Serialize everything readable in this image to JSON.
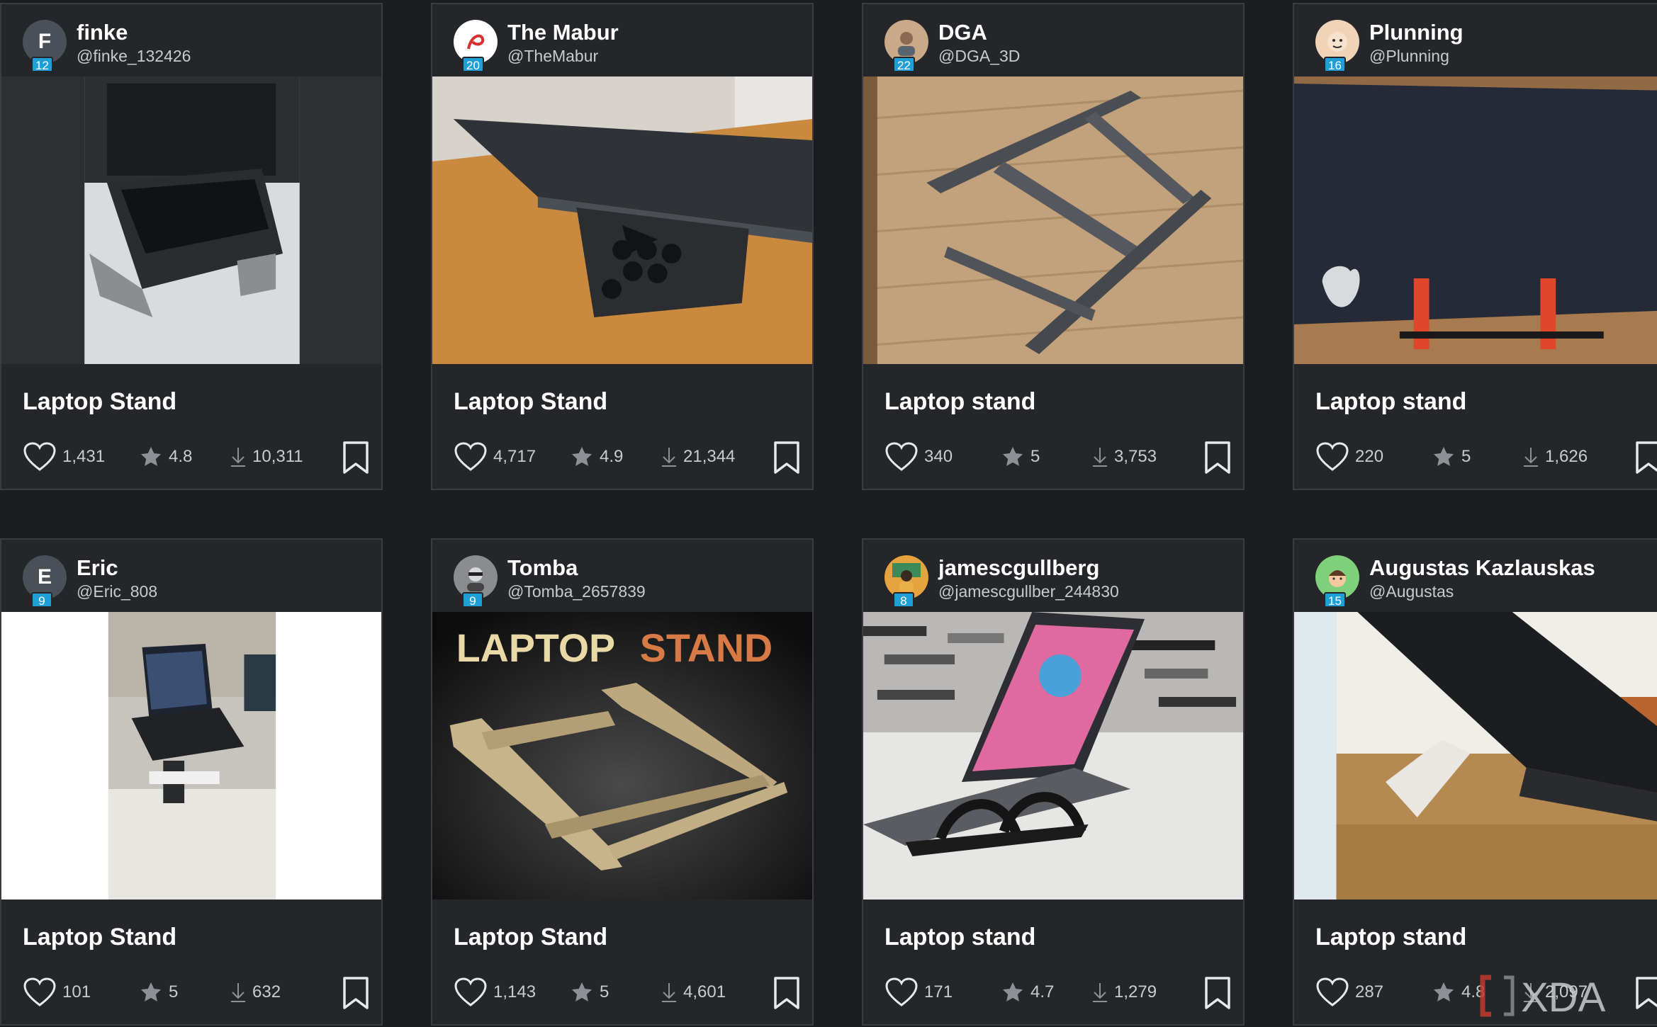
{
  "cards": [
    {
      "user": {
        "name": "finke",
        "handle": "@finke_132426",
        "initial": "F",
        "level": "12",
        "avatar_color": "#4b4f57"
      },
      "title": "Laptop Stand",
      "likes": "1,431",
      "rating": "4.8",
      "downloads": "10,311",
      "image": "thinkpad-on-printed-stand-photo"
    },
    {
      "user": {
        "name": "The Mabur",
        "handle": "@TheMabur",
        "initial": "",
        "level": "20",
        "avatar_color": "#ffffff"
      },
      "title": "Laptop Stand",
      "likes": "4,717",
      "rating": "4.9",
      "downloads": "21,344",
      "image": "honeycomb-stand-under-laptop-photo"
    },
    {
      "user": {
        "name": "DGA",
        "handle": "@DGA_3D",
        "initial": "",
        "level": "22",
        "avatar_color": "#c9a98a"
      },
      "title": "Laptop stand",
      "likes": "340",
      "rating": "5",
      "downloads": "3,753",
      "image": "carbon-fiber-folding-stand-photo"
    },
    {
      "user": {
        "name": "Plunning",
        "handle": "@Plunning",
        "initial": "",
        "level": "16",
        "avatar_color": "#f0d4b8"
      },
      "title": "Laptop stand",
      "likes": "220",
      "rating": "5",
      "downloads": "1,626",
      "image": "vertical-laptop-holder-photo"
    },
    {
      "user": {
        "name": "Eric",
        "handle": "@Eric_808",
        "initial": "E",
        "level": "9",
        "avatar_color": "#4b4f57"
      },
      "title": "Laptop Stand",
      "likes": "101",
      "rating": "5",
      "downloads": "632",
      "image": "laptop-on-desk-clamp-arm-photo"
    },
    {
      "user": {
        "name": "Tomba",
        "handle": "@Tomba_2657839",
        "initial": "",
        "level": "9",
        "avatar_color": "#8a8c90"
      },
      "title": "Laptop Stand",
      "likes": "1,143",
      "rating": "5",
      "downloads": "4,601",
      "image": "laptop-stand-render",
      "image_text_1": "LAPTOP",
      "image_text_2": "STAND"
    },
    {
      "user": {
        "name": "jamescgullberg",
        "handle": "@jamescgullber_244830",
        "initial": "",
        "level": "8",
        "avatar_color": "#e6a23c"
      },
      "title": "Laptop stand",
      "likes": "171",
      "rating": "4.7",
      "downloads": "1,279",
      "image": "macbook-on-curved-stand-photo"
    },
    {
      "user": {
        "name": "Augustas Kazlauskas",
        "handle": "@Augustas",
        "initial": "",
        "level": "15",
        "avatar_color": "#7ed07a"
      },
      "title": "Laptop stand",
      "likes": "287",
      "rating": "4.8",
      "downloads": "2,097",
      "image": "white-legs-under-laptop-photo"
    }
  ],
  "watermark": "XDA",
  "icons": {
    "like": "heart-icon",
    "rating": "star-icon",
    "downloads": "download-icon",
    "save": "bookmark-icon"
  },
  "colors": {
    "background": "#1b1c1f",
    "card": "#24262a",
    "badge": "#1e9fd8",
    "stand_accent": "#e05a2b"
  }
}
